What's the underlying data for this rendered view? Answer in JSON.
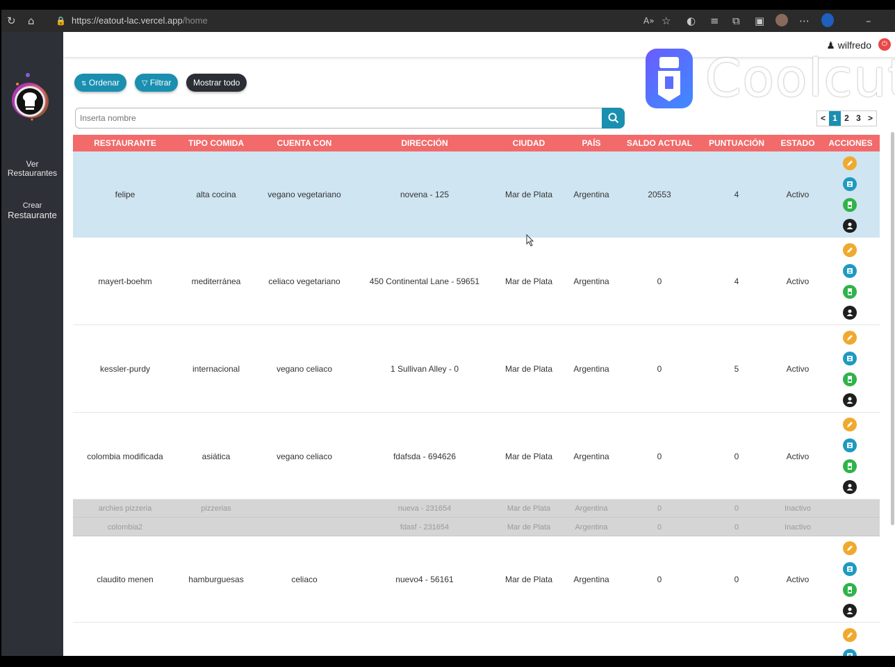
{
  "browser": {
    "url_host": "https://eatout-lac.vercel.app",
    "url_path": "/home"
  },
  "sidebar": {
    "items": [
      {
        "line1": "Ver",
        "line2": "Restaurantes"
      },
      {
        "line1": "Crear",
        "line2": "Restaurante"
      }
    ]
  },
  "header": {
    "user_name": "wilfredo"
  },
  "watermark": {
    "text": "Coolcut"
  },
  "toolbar": {
    "order_label": "Ordenar",
    "filter_label": "Filtrar",
    "show_all_label": "Mostrar todo"
  },
  "search": {
    "placeholder": "Inserta nombre"
  },
  "pagination": {
    "prev": "<",
    "pages": [
      "1",
      "2",
      "3"
    ],
    "current": "1",
    "next": ">"
  },
  "table": {
    "columns": [
      "RESTAURANTE",
      "TIPO COMIDA",
      "CUENTA CON",
      "DIRECCIÓN",
      "CIUDAD",
      "PAÍS",
      "SALDO ACTUAL",
      "PUNTUACIÓN",
      "ESTADO",
      "ACCIONES"
    ],
    "rows": [
      {
        "name": "felipe",
        "type": "alta cocina",
        "features": "vegano vegetariano",
        "address": "novena - 125",
        "city": "Mar de Plata",
        "country": "Argentina",
        "balance": "20553",
        "score": "4",
        "status": "Activo"
      },
      {
        "name": "mayert-boehm",
        "type": "mediterránea",
        "features": "celiaco vegetariano",
        "address": "450 Continental Lane - 59651",
        "city": "Mar de Plata",
        "country": "Argentina",
        "balance": "0",
        "score": "4",
        "status": "Activo"
      },
      {
        "name": "kessler-purdy",
        "type": "internacional",
        "features": "vegano celiaco",
        "address": "1 Sullivan Alley - 0",
        "city": "Mar de Plata",
        "country": "Argentina",
        "balance": "0",
        "score": "5",
        "status": "Activo"
      },
      {
        "name": "colombia modificada",
        "type": "asiática",
        "features": "vegano celiaco",
        "address": "fdafsda - 694626",
        "city": "Mar de Plata",
        "country": "Argentina",
        "balance": "0",
        "score": "0",
        "status": "Activo"
      },
      {
        "name": "archies pizzeria",
        "type": "pizzerias",
        "features": "",
        "address": "nueva - 231654",
        "city": "Mar de Plata",
        "country": "Argentina",
        "balance": "0",
        "score": "0",
        "status": "Inactivo"
      },
      {
        "name": "colombia2",
        "type": "",
        "features": "",
        "address": "fdasf - 231654",
        "city": "Mar de Plata",
        "country": "Argentina",
        "balance": "0",
        "score": "0",
        "status": "Inactivo"
      },
      {
        "name": "claudito menen",
        "type": "hamburguesas",
        "features": "celiaco",
        "address": "nuevo4 - 56161",
        "city": "Mar de Plata",
        "country": "Argentina",
        "balance": "0",
        "score": "0",
        "status": "Activo"
      }
    ]
  },
  "colors": {
    "accent": "#1a8fb0",
    "table_header": "#f26a6a",
    "sidebar": "#2d3036",
    "highlight_row": "#cfe5f1",
    "inactive_row": "#d5d5d5"
  },
  "icons": [
    "edit-icon",
    "menu-icon",
    "document-icon",
    "user-icon",
    "search-icon",
    "sort-icon",
    "filter-icon"
  ]
}
